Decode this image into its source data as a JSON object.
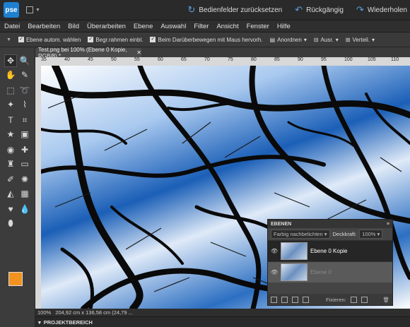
{
  "topbar": {
    "logo": "pse",
    "reset_label": "Bedienfelder zurücksetzen",
    "undo_label": "Rückgängig",
    "redo_label": "Wiederholen"
  },
  "menu": [
    "Datei",
    "Bearbeiten",
    "Bild",
    "Überarbeiten",
    "Ebene",
    "Auswahl",
    "Filter",
    "Ansicht",
    "Fenster",
    "Hilfe"
  ],
  "options": {
    "auto_select": "Ebene autom. wählen",
    "show_bbox": "Begr.rahmen einbl.",
    "hover_highlight": "Beim Darüberbewegen mit Maus hervorh.",
    "arrange": "Anordnen",
    "align": "Ausr.",
    "distribute": "Verteil."
  },
  "document": {
    "tab_title": "Test.png bei 100% (Ebene 0 Kopie, RGB/8) *",
    "zoom": "100%",
    "dimensions": "204,92 cm x 136,58 cm (24,79 ..."
  },
  "ruler_ticks": [
    "35",
    "40",
    "45",
    "50",
    "55",
    "60",
    "65",
    "70",
    "75",
    "80",
    "85",
    "90",
    "95",
    "100",
    "105",
    "110"
  ],
  "project_area": "PROJEKTBEREICH",
  "layers_panel": {
    "title": "EBENEN",
    "blend_mode": "Farbig nachbelichten",
    "opacity_label": "Deckkraft:",
    "opacity_value": "100%",
    "lock_label": "Fixieren:",
    "layers": [
      {
        "name": "Ebene 0 Kopie"
      },
      {
        "name": "Ebene 0"
      }
    ]
  },
  "colors": {
    "foreground": "#f2921f",
    "background": "#ffffff",
    "accent": "#1f7fd0"
  }
}
